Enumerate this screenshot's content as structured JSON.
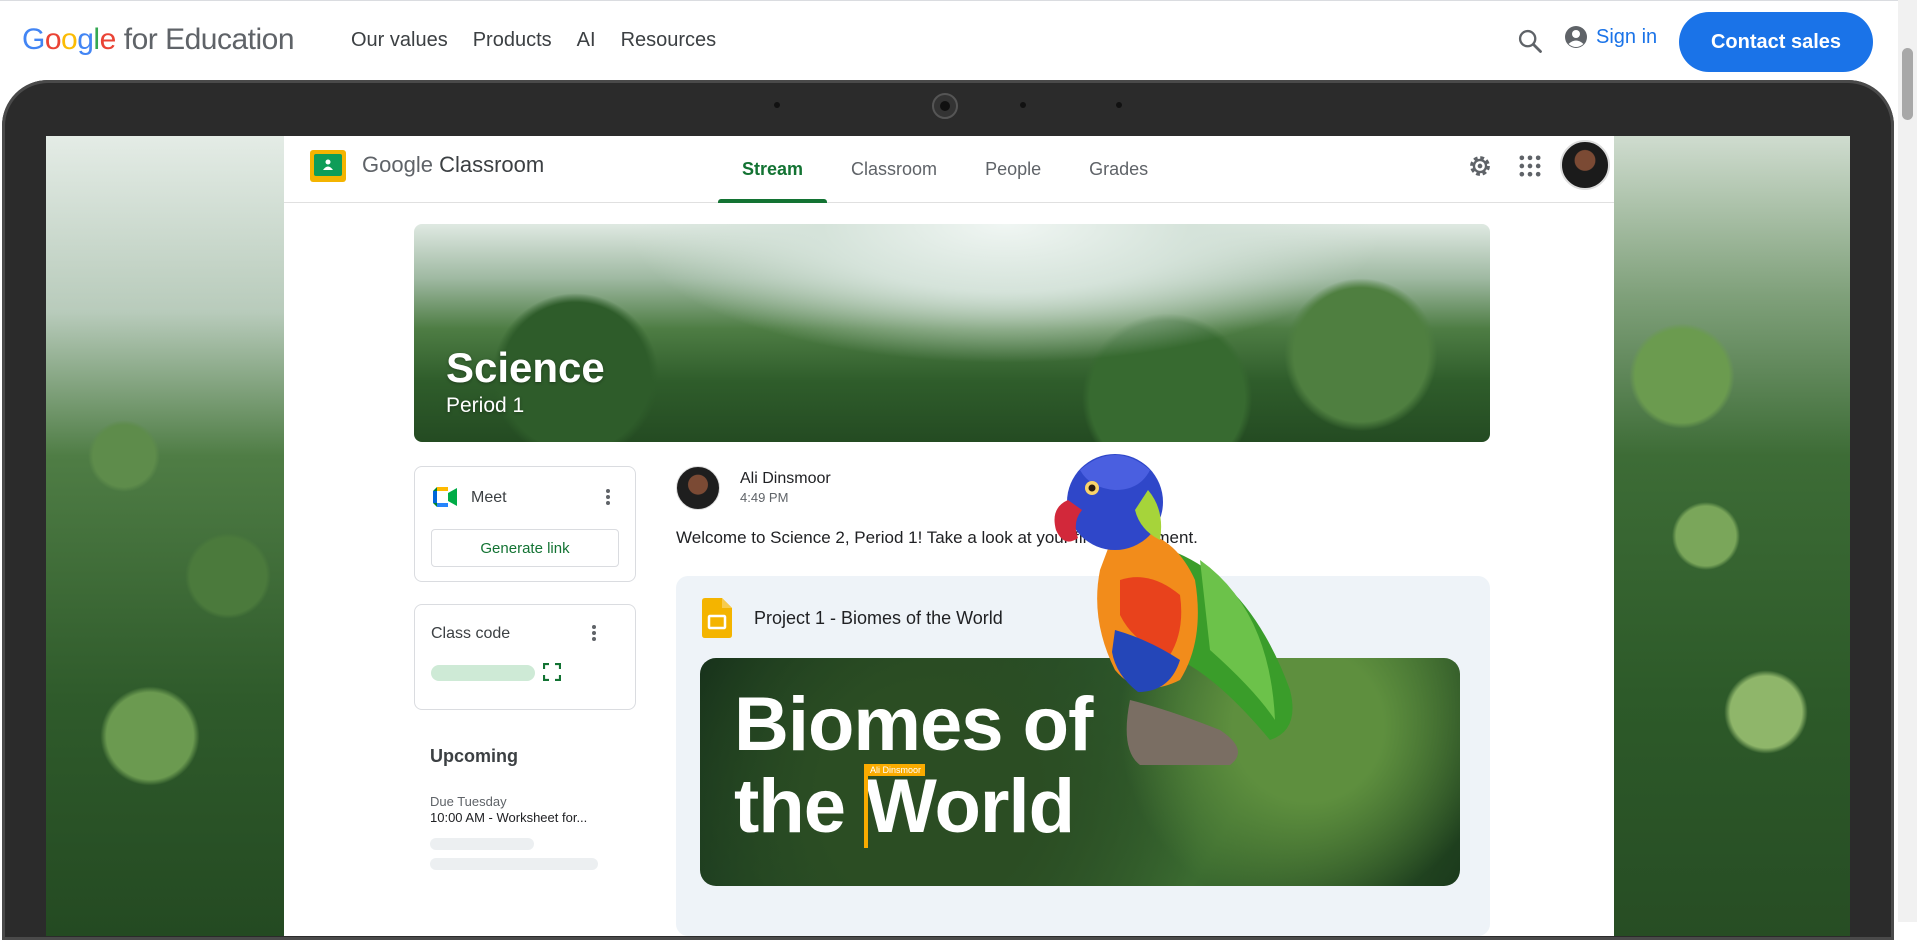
{
  "site": {
    "logo_letters": [
      {
        "ch": "G",
        "color": "#4285F4"
      },
      {
        "ch": "o",
        "color": "#EA4335"
      },
      {
        "ch": "o",
        "color": "#FBBC05"
      },
      {
        "ch": "g",
        "color": "#4285F4"
      },
      {
        "ch": "l",
        "color": "#34A853"
      },
      {
        "ch": "e",
        "color": "#EA4335"
      }
    ],
    "logo_suffix": "for Education",
    "nav": [
      "Our values",
      "Products",
      "AI",
      "Resources"
    ],
    "sign_in": "Sign in",
    "contact": "Contact sales",
    "accent": "#1a73e8"
  },
  "classroom": {
    "title_a": "Google",
    "title_b": "Classroom",
    "tabs": [
      "Stream",
      "Classroom",
      "People",
      "Grades"
    ],
    "active_tab": "Stream",
    "accent": "#137333",
    "banner": {
      "title": "Science",
      "subtitle": "Period 1"
    },
    "meet": {
      "label": "Meet",
      "button": "Generate link"
    },
    "class_code": {
      "label": "Class code"
    },
    "upcoming": {
      "title": "Upcoming",
      "due": "Due Tuesday",
      "item": "10:00 AM - Worksheet for..."
    },
    "post": {
      "author": "Ali Dinsmoor",
      "time": "4:49 PM",
      "text": "Welcome to Science 2, Period 1! Take a look at your first assignment.",
      "attachment_title": "Project 1 - Biomes of the World",
      "preview_title": "Biomes of\nthe World",
      "cursor_label": "Ali Dinsmoor"
    }
  },
  "icons": [
    "search-icon",
    "account-circle-icon",
    "gear-icon",
    "apps-grid-icon",
    "meet-icon",
    "more-vert-icon",
    "fullscreen-icon",
    "slides-icon"
  ]
}
